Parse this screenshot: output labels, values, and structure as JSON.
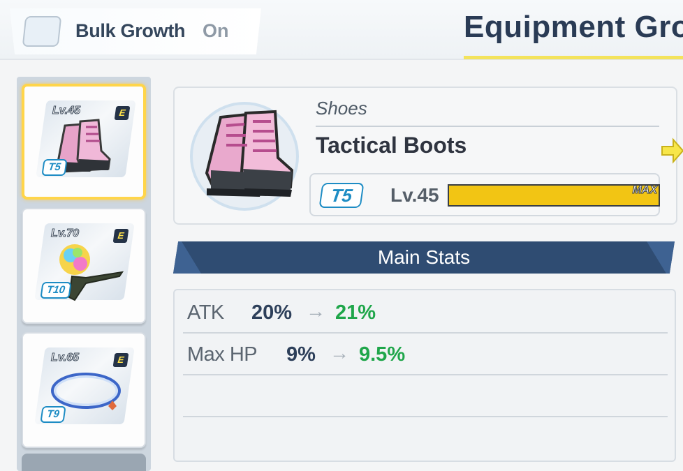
{
  "header": {
    "bulk_growth_label": "Bulk Growth",
    "bulk_growth_state": "On",
    "title": "Equipment Gro"
  },
  "equipment_list": [
    {
      "level": "Lv.45",
      "rank": "E",
      "tier": "T5",
      "icon": "pink-camo-boots-icon",
      "selected": true
    },
    {
      "level": "Lv.70",
      "rank": "E",
      "tier": "T10",
      "icon": "rainbow-orb-staff-icon",
      "selected": false
    },
    {
      "level": "Lv.65",
      "rank": "E",
      "tier": "T9",
      "icon": "blue-necklace-icon",
      "selected": false
    }
  ],
  "detail": {
    "category": "Shoes",
    "name": "Tactical Boots",
    "tier": "T5",
    "level": "Lv.45",
    "bar_label": "MAX",
    "bar_fill": 1.0
  },
  "main_stats": {
    "title": "Main Stats",
    "rows": [
      {
        "name": "ATK",
        "from": "20%",
        "arrow": "→",
        "to": "21%"
      },
      {
        "name": "Max HP",
        "from": "9%",
        "arrow": "→",
        "to": "9.5%"
      }
    ]
  },
  "colors": {
    "accent_yellow": "#f2c514",
    "stats_header_blue": "#2f4c72",
    "increase_green": "#1fa64a",
    "tier_blue": "#1d8cc4"
  }
}
